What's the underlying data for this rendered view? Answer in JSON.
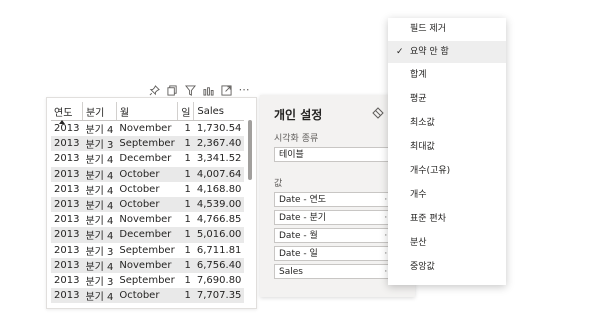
{
  "table": {
    "headers": [
      "연도",
      "분기",
      "월",
      "일",
      "Sales"
    ],
    "rows": [
      [
        "2013",
        "분기 4",
        "November",
        "1",
        "1,730.54"
      ],
      [
        "2013",
        "분기 3",
        "September",
        "1",
        "2,367.40"
      ],
      [
        "2013",
        "분기 4",
        "December",
        "1",
        "3,341.52"
      ],
      [
        "2013",
        "분기 4",
        "October",
        "1",
        "4,007.64"
      ],
      [
        "2013",
        "분기 4",
        "October",
        "1",
        "4,168.80"
      ],
      [
        "2013",
        "분기 4",
        "October",
        "1",
        "4,539.00"
      ],
      [
        "2013",
        "분기 4",
        "November",
        "1",
        "4,766.85"
      ],
      [
        "2013",
        "분기 4",
        "December",
        "1",
        "5,016.00"
      ],
      [
        "2013",
        "분기 3",
        "September",
        "1",
        "6,711.81"
      ],
      [
        "2013",
        "분기 4",
        "November",
        "1",
        "6,756.40"
      ],
      [
        "2013",
        "분기 3",
        "September",
        "1",
        "7,690.80"
      ],
      [
        "2013",
        "분기 4",
        "October",
        "1",
        "7,707.35"
      ]
    ]
  },
  "toolbar": {
    "icons": [
      "pin-icon",
      "copy-icon",
      "filter-icon",
      "focus-mode-icon",
      "expand-icon",
      "more-options-icon"
    ],
    "more_label": "⋯"
  },
  "settings": {
    "title": "개인 설정",
    "viz_type_label": "시각화 종류",
    "viz_type_value": "테이블",
    "values_label": "값",
    "fields": [
      "Date - 연도",
      "Date - 분기",
      "Date - 월",
      "Date - 일",
      "Sales"
    ],
    "field_more": "···"
  },
  "menu": {
    "items": [
      "필드 제거",
      "요약 안 함",
      "합계",
      "평균",
      "최소값",
      "최대값",
      "개수(고유)",
      "개수",
      "표준 편차",
      "분산",
      "중앙값"
    ],
    "selected_index": 1,
    "check_mark": "✓"
  },
  "colors": {
    "alt_row": "#e9e9e9",
    "panel_bg": "#f3f2f1",
    "selected_item": "#eeeeee"
  }
}
